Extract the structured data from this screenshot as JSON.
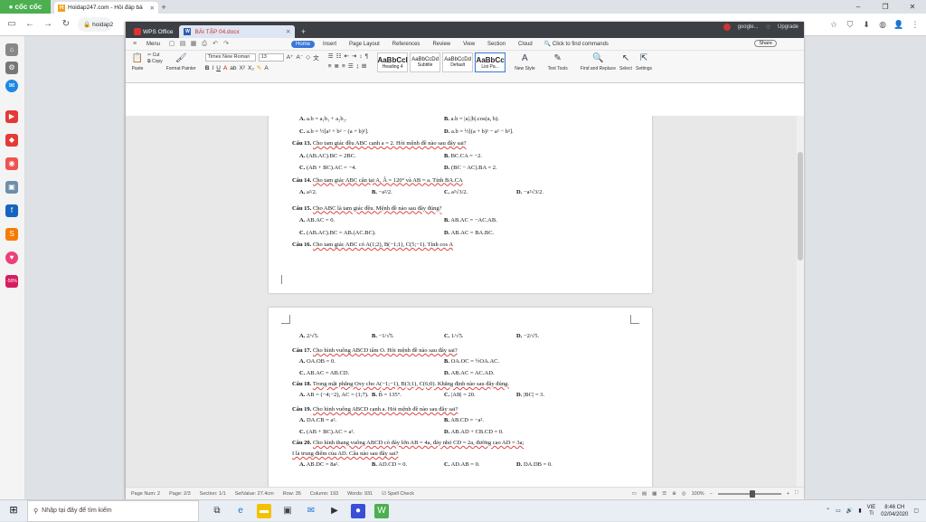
{
  "browser": {
    "brand": "cốc cốc",
    "tab_title": "Hoidap247.com - Hỏi đáp bà",
    "tab_favicon": "H",
    "url": "hoidap2",
    "new_tab": "+",
    "win_min": "–",
    "win_max": "❐",
    "win_close": "✕"
  },
  "wps": {
    "app_label": "WPS Office",
    "doc_tab": "BÀI TẬP 04.docx",
    "new_tab": "+",
    "account": "google...",
    "upgrade": "Upgrade",
    "menu_label": "Menu",
    "tabs": [
      "Home",
      "Insert",
      "Page Layout",
      "References",
      "Review",
      "View",
      "Section",
      "Cloud"
    ],
    "active_tab": "Home",
    "search": "Click to find commands",
    "share": "Share",
    "ribbon": {
      "paste": "Paste",
      "cut": "Cut",
      "copy": "Copy",
      "format_painter": "Format Painter",
      "font": "Times New Roman",
      "size": "13",
      "bold": "B",
      "italic": "I",
      "underline": "U",
      "styles": [
        {
          "sample": "AaBbCcI",
          "label": "Heading 4"
        },
        {
          "sample": "AaBbCcDd",
          "label": "Subtitle"
        },
        {
          "sample": "AaBbCcDd",
          "label": "Default"
        },
        {
          "sample": "AaBbCc",
          "label": "List Pa..."
        }
      ],
      "new_style": "New Style",
      "text_tools": "Text Tools",
      "find_replace": "Find and Replace",
      "select": "Select",
      "settings": "Settings"
    }
  },
  "doc": {
    "page1": [
      {
        "type": "opts",
        "items": [
          {
            "k": "A.",
            "t": "a.b = a₁b₁ + a₂b₂."
          },
          {
            "k": "B.",
            "t": "a.b = |a|.|b|.cos(a, b)."
          }
        ]
      },
      {
        "type": "opts",
        "items": [
          {
            "k": "C.",
            "t": "a.b = ½[a² + b² − (a + b)²]."
          },
          {
            "k": "D.",
            "t": "a.b = ½[(a + b)² − a² − b²]."
          }
        ]
      },
      {
        "type": "q",
        "num": "Câu 13.",
        "t": "Cho tam giác đều ABC cạnh a = 2. Hỏi mệnh đề nào sau đây sai?"
      },
      {
        "type": "opts",
        "items": [
          {
            "k": "A.",
            "t": "(AB.AC).BC = 2BC."
          },
          {
            "k": "B.",
            "t": "BC.CA = −2."
          }
        ]
      },
      {
        "type": "opts",
        "items": [
          {
            "k": "C.",
            "t": "(AB + BC).AC = −4."
          },
          {
            "k": "D.",
            "t": "(BC − AC).BA = 2."
          }
        ]
      },
      {
        "type": "q",
        "num": "Câu 14.",
        "t": "Cho tam giác ABC cân tại A, Â = 120° và AB = a. Tính BA.CA"
      },
      {
        "type": "opts4",
        "items": [
          {
            "k": "A.",
            "t": "a²/2."
          },
          {
            "k": "B.",
            "t": "−a²/2."
          },
          {
            "k": "C.",
            "t": "a²√3/2."
          },
          {
            "k": "D.",
            "t": "−a²√3/2."
          }
        ]
      },
      {
        "type": "q",
        "num": "Câu 15.",
        "t": "Cho ABC là tam giác đều. Mệnh đề nào sau đây đúng?"
      },
      {
        "type": "opts",
        "items": [
          {
            "k": "A.",
            "t": "AB.AC = 0."
          },
          {
            "k": "B.",
            "t": "AB.AC = −AC.AB."
          }
        ]
      },
      {
        "type": "opts",
        "items": [
          {
            "k": "C.",
            "t": "(AB.AC).BC = AB.(AC.BC)."
          },
          {
            "k": "D.",
            "t": "AB.AC = BA.BC."
          }
        ]
      },
      {
        "type": "q",
        "num": "Câu 16.",
        "t": "Cho tam giác ABC có A(1;2), B(−1;1), C(5;−1). Tính cos A"
      }
    ],
    "page2": [
      {
        "type": "opts4",
        "items": [
          {
            "k": "A.",
            "t": "2/√5."
          },
          {
            "k": "B.",
            "t": "−1/√5."
          },
          {
            "k": "C.",
            "t": "1/√5."
          },
          {
            "k": "D.",
            "t": "−2/√5."
          }
        ]
      },
      {
        "type": "q",
        "num": "Câu 17.",
        "t": "Cho hình vuông ABCD tâm O. Hỏi mệnh đề nào sau đây sai?"
      },
      {
        "type": "opts",
        "items": [
          {
            "k": "A.",
            "t": "OA.OB = 0."
          },
          {
            "k": "B.",
            "t": "OA.OC = ½OA.AC."
          }
        ]
      },
      {
        "type": "opts",
        "items": [
          {
            "k": "C.",
            "t": "AB.AC = AB.CD."
          },
          {
            "k": "D.",
            "t": "AB.AC = AC.AD."
          }
        ]
      },
      {
        "type": "q",
        "num": "Câu 18.",
        "t": "Trong mặt phẳng Oxy cho A(−1;−1), B(3;1), C(6;0). Khẳng định nào sau đây đúng."
      },
      {
        "type": "opts4",
        "items": [
          {
            "k": "A.",
            "t": "AB = (−4;−2), AC = (1;7)."
          },
          {
            "k": "B.",
            "t": "B̂ = 135°."
          },
          {
            "k": "C.",
            "t": "|AB| = 20."
          },
          {
            "k": "D.",
            "t": "|BC| = 3."
          }
        ]
      },
      {
        "type": "q",
        "num": "Câu 19.",
        "t": "Cho hình vuông ABCD cạnh a. Hỏi mệnh đề nào sau đây sai?"
      },
      {
        "type": "opts",
        "items": [
          {
            "k": "A.",
            "t": "DA.CB = a²."
          },
          {
            "k": "B.",
            "t": "AB.CD = −a²."
          }
        ]
      },
      {
        "type": "opts",
        "items": [
          {
            "k": "C.",
            "t": "(AB + BC).AC = a²."
          },
          {
            "k": "D.",
            "t": "AB.AD + CB.CD = 0."
          }
        ]
      },
      {
        "type": "q",
        "num": "Câu 20.",
        "t": "Cho hình thang vuông ABCD có đáy lớn AB = 4a, đáy nhỏ CD = 2a, đường cao AD = 3a;"
      },
      {
        "type": "cont",
        "t": "I là trung điểm của AD. Câu nào sau đây sai?"
      },
      {
        "type": "opts4",
        "items": [
          {
            "k": "A.",
            "t": "AB.DC = 8a²."
          },
          {
            "k": "B.",
            "t": "AD.CD = 0."
          },
          {
            "k": "C.",
            "t": "AD.AB = 0."
          },
          {
            "k": "D.",
            "t": "DA.DB = 0."
          }
        ]
      }
    ]
  },
  "status": {
    "page_num": "Page Num: 2",
    "page": "Page: 2/3",
    "section": "Section: 1/1",
    "setvalue": "SetValue: 27.4cm",
    "row": "Row: 35",
    "column": "Column: 193",
    "words": "Words: 931",
    "spell": "Spell Check",
    "zoom": "100%"
  },
  "taskbar": {
    "search_placeholder": "Nhập tại đây để tìm kiếm",
    "lang": "VIE",
    "time": "8:46 CH",
    "date": "02/04/2020"
  }
}
